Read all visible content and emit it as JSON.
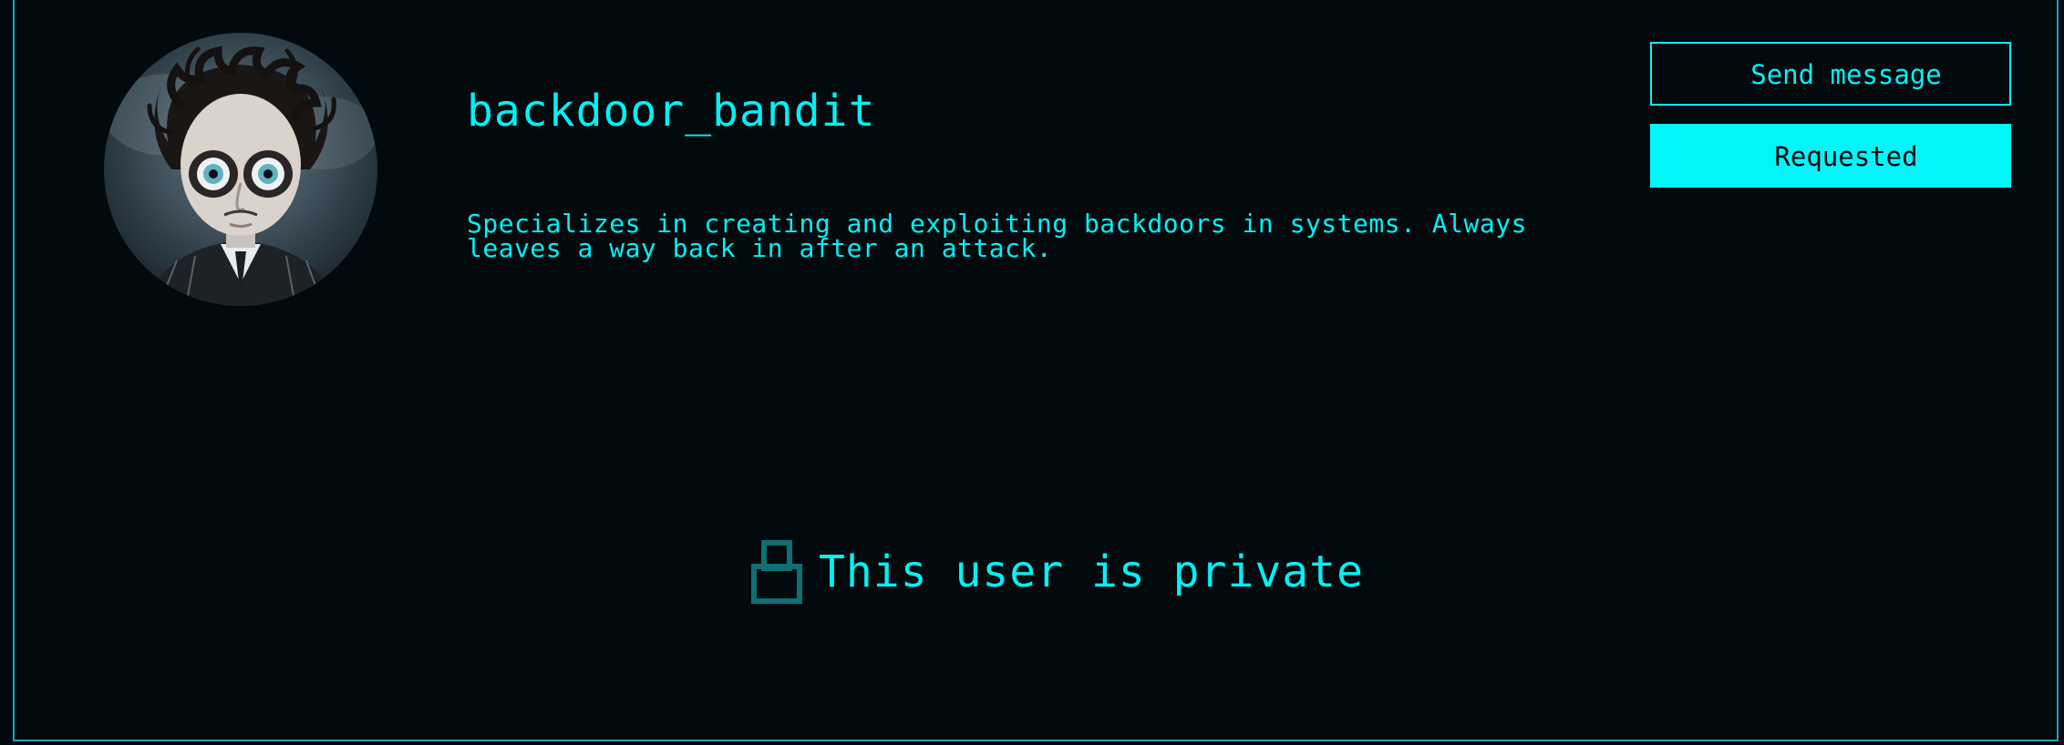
{
  "profile": {
    "username": "backdoor_bandit",
    "bio": "Specializes in creating and exploiting backdoors in systems. Always leaves a way back in after an attack."
  },
  "actions": {
    "send_message_label": "Send message",
    "requested_label": "Requested"
  },
  "privacy": {
    "icon": "lock-icon",
    "message": "This user is private"
  },
  "colors": {
    "background": "#02080b",
    "accent": "#00f2f6",
    "lock_icon": "#0e6f74"
  }
}
